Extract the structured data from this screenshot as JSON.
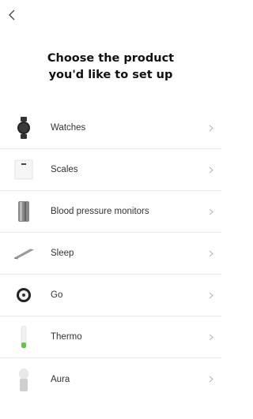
{
  "header": {
    "back_icon": "chevron-left-icon",
    "title_line1": "Choose the product",
    "title_line2": "you'd like to set up"
  },
  "products": [
    {
      "label": "Watches",
      "icon": "watch-icon"
    },
    {
      "label": "Scales",
      "icon": "scale-icon"
    },
    {
      "label": "Blood pressure monitors",
      "icon": "blood-pressure-monitor-icon"
    },
    {
      "label": "Sleep",
      "icon": "sleep-mat-icon"
    },
    {
      "label": "Go",
      "icon": "go-tracker-icon"
    },
    {
      "label": "Thermo",
      "icon": "thermometer-icon"
    },
    {
      "label": "Aura",
      "icon": "aura-lamp-icon"
    }
  ],
  "colors": {
    "divider": "#e9e9e9",
    "chevron": "#b0b0b0",
    "accent_green": "#6cc24a"
  }
}
